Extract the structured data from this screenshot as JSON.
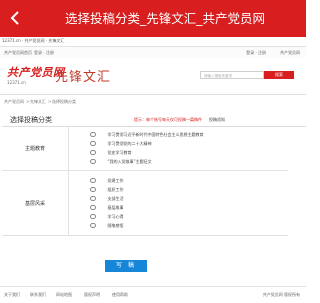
{
  "window": {
    "title": "选择投稿分类_先锋文汇_共产党员网"
  },
  "url": {
    "text": "12371.cn · 共产党员网 · 先锋文汇"
  },
  "toolbar": {
    "left_1": "共产党员网首页",
    "left_2": "登录 · 注册",
    "right_1": "登录 · 注册",
    "right_2": "共产党员网"
  },
  "brand": {
    "logo_text": "共产党员网",
    "logo_sub": "12371.cn",
    "channel": "先锋文汇",
    "search_placeholder": "请输入搜索关键词",
    "search_button": "搜索"
  },
  "breadcrumb": {
    "home": "共产党员网",
    "section": "先锋文汇",
    "current": "选择投稿分类"
  },
  "panel": {
    "label": "选择投稿分类",
    "notice": "提示：每个账号每天仅可投稿一篇稿件",
    "tip": "投稿须知"
  },
  "categories": [
    {
      "name": "主题教育",
      "items": [
        "学习贯彻习近平新时代中国特色社会主义思想主题教育",
        "学习贯彻党的二十大精神",
        "党史学习教育",
        "“我的入党故事”主题征文"
      ]
    },
    {
      "name": "基层风采",
      "items": [
        "党建工作",
        "组织工作",
        "支部生活",
        "基层故事",
        "学习心得",
        "随笔感悟"
      ]
    }
  ],
  "submit": {
    "label": "写 稿"
  },
  "footer": {
    "col_1": "关于我们",
    "col_2": "联系我们",
    "col_3": "网站地图",
    "col_4": "版权声明",
    "col_5": "使用帮助",
    "right": "共产党员网 版权所有"
  },
  "colors": {
    "brand_red": "#d81e1e",
    "submit_blue": "#1686d8"
  }
}
